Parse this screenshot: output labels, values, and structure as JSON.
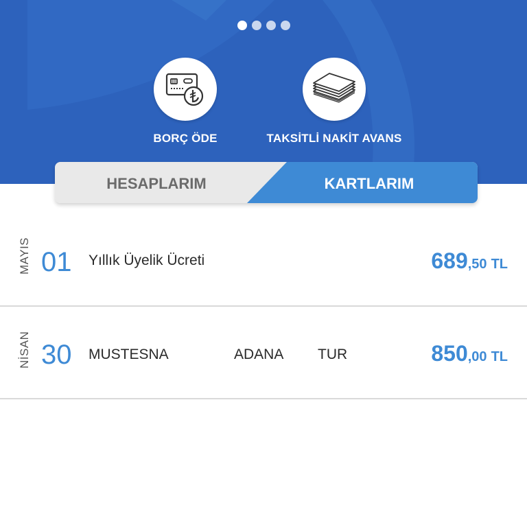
{
  "header": {
    "pager": {
      "count": 4,
      "active_index": 0
    },
    "actions": [
      {
        "label": "BORÇ ÖDE",
        "icon": "card-lira-icon"
      },
      {
        "label": "TAKSİTLİ NAKİT AVANS",
        "icon": "banknotes-stack-icon"
      }
    ]
  },
  "tabs": {
    "accounts_label": "HESAPLARIM",
    "cards_label": "KARTLARIM",
    "active": "cards"
  },
  "transactions": [
    {
      "month": "MAYIS",
      "day": "01",
      "description": "Yıllık Üyelik Ücreti",
      "city": "",
      "country": "",
      "amount_int": "689",
      "amount_dec": ",50",
      "currency": "TL"
    },
    {
      "month": "NİSAN",
      "day": "30",
      "description": "MUSTESNA",
      "city": "ADANA",
      "country": "TUR",
      "amount_int": "850",
      "amount_dec": ",00",
      "currency": "TL"
    }
  ],
  "colors": {
    "header_blue": "#2d62bc",
    "accent_blue": "#3e8ad5",
    "tab_inactive": "#e9e9e9"
  }
}
